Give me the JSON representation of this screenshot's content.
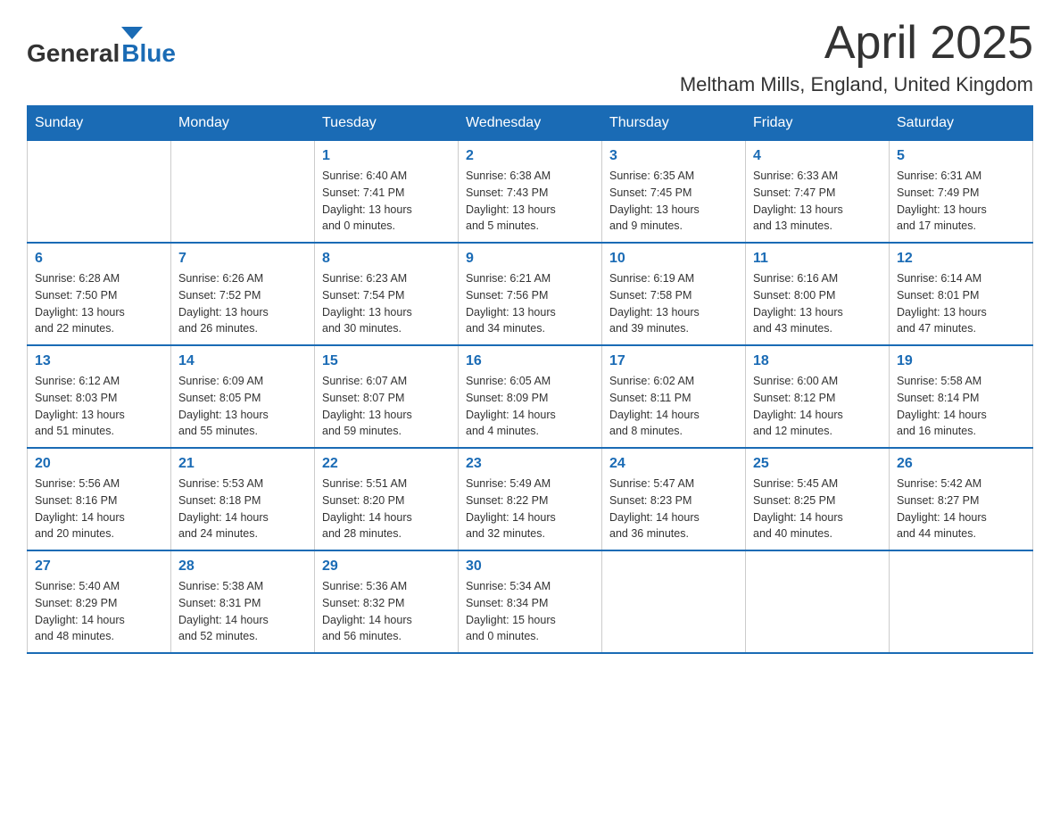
{
  "header": {
    "logo_general": "General",
    "logo_blue": "Blue",
    "month_year": "April 2025",
    "location": "Meltham Mills, England, United Kingdom"
  },
  "weekdays": [
    "Sunday",
    "Monday",
    "Tuesday",
    "Wednesday",
    "Thursday",
    "Friday",
    "Saturday"
  ],
  "weeks": [
    [
      {
        "day": "",
        "info": []
      },
      {
        "day": "",
        "info": []
      },
      {
        "day": "1",
        "info": [
          "Sunrise: 6:40 AM",
          "Sunset: 7:41 PM",
          "Daylight: 13 hours",
          "and 0 minutes."
        ]
      },
      {
        "day": "2",
        "info": [
          "Sunrise: 6:38 AM",
          "Sunset: 7:43 PM",
          "Daylight: 13 hours",
          "and 5 minutes."
        ]
      },
      {
        "day": "3",
        "info": [
          "Sunrise: 6:35 AM",
          "Sunset: 7:45 PM",
          "Daylight: 13 hours",
          "and 9 minutes."
        ]
      },
      {
        "day": "4",
        "info": [
          "Sunrise: 6:33 AM",
          "Sunset: 7:47 PM",
          "Daylight: 13 hours",
          "and 13 minutes."
        ]
      },
      {
        "day": "5",
        "info": [
          "Sunrise: 6:31 AM",
          "Sunset: 7:49 PM",
          "Daylight: 13 hours",
          "and 17 minutes."
        ]
      }
    ],
    [
      {
        "day": "6",
        "info": [
          "Sunrise: 6:28 AM",
          "Sunset: 7:50 PM",
          "Daylight: 13 hours",
          "and 22 minutes."
        ]
      },
      {
        "day": "7",
        "info": [
          "Sunrise: 6:26 AM",
          "Sunset: 7:52 PM",
          "Daylight: 13 hours",
          "and 26 minutes."
        ]
      },
      {
        "day": "8",
        "info": [
          "Sunrise: 6:23 AM",
          "Sunset: 7:54 PM",
          "Daylight: 13 hours",
          "and 30 minutes."
        ]
      },
      {
        "day": "9",
        "info": [
          "Sunrise: 6:21 AM",
          "Sunset: 7:56 PM",
          "Daylight: 13 hours",
          "and 34 minutes."
        ]
      },
      {
        "day": "10",
        "info": [
          "Sunrise: 6:19 AM",
          "Sunset: 7:58 PM",
          "Daylight: 13 hours",
          "and 39 minutes."
        ]
      },
      {
        "day": "11",
        "info": [
          "Sunrise: 6:16 AM",
          "Sunset: 8:00 PM",
          "Daylight: 13 hours",
          "and 43 minutes."
        ]
      },
      {
        "day": "12",
        "info": [
          "Sunrise: 6:14 AM",
          "Sunset: 8:01 PM",
          "Daylight: 13 hours",
          "and 47 minutes."
        ]
      }
    ],
    [
      {
        "day": "13",
        "info": [
          "Sunrise: 6:12 AM",
          "Sunset: 8:03 PM",
          "Daylight: 13 hours",
          "and 51 minutes."
        ]
      },
      {
        "day": "14",
        "info": [
          "Sunrise: 6:09 AM",
          "Sunset: 8:05 PM",
          "Daylight: 13 hours",
          "and 55 minutes."
        ]
      },
      {
        "day": "15",
        "info": [
          "Sunrise: 6:07 AM",
          "Sunset: 8:07 PM",
          "Daylight: 13 hours",
          "and 59 minutes."
        ]
      },
      {
        "day": "16",
        "info": [
          "Sunrise: 6:05 AM",
          "Sunset: 8:09 PM",
          "Daylight: 14 hours",
          "and 4 minutes."
        ]
      },
      {
        "day": "17",
        "info": [
          "Sunrise: 6:02 AM",
          "Sunset: 8:11 PM",
          "Daylight: 14 hours",
          "and 8 minutes."
        ]
      },
      {
        "day": "18",
        "info": [
          "Sunrise: 6:00 AM",
          "Sunset: 8:12 PM",
          "Daylight: 14 hours",
          "and 12 minutes."
        ]
      },
      {
        "day": "19",
        "info": [
          "Sunrise: 5:58 AM",
          "Sunset: 8:14 PM",
          "Daylight: 14 hours",
          "and 16 minutes."
        ]
      }
    ],
    [
      {
        "day": "20",
        "info": [
          "Sunrise: 5:56 AM",
          "Sunset: 8:16 PM",
          "Daylight: 14 hours",
          "and 20 minutes."
        ]
      },
      {
        "day": "21",
        "info": [
          "Sunrise: 5:53 AM",
          "Sunset: 8:18 PM",
          "Daylight: 14 hours",
          "and 24 minutes."
        ]
      },
      {
        "day": "22",
        "info": [
          "Sunrise: 5:51 AM",
          "Sunset: 8:20 PM",
          "Daylight: 14 hours",
          "and 28 minutes."
        ]
      },
      {
        "day": "23",
        "info": [
          "Sunrise: 5:49 AM",
          "Sunset: 8:22 PM",
          "Daylight: 14 hours",
          "and 32 minutes."
        ]
      },
      {
        "day": "24",
        "info": [
          "Sunrise: 5:47 AM",
          "Sunset: 8:23 PM",
          "Daylight: 14 hours",
          "and 36 minutes."
        ]
      },
      {
        "day": "25",
        "info": [
          "Sunrise: 5:45 AM",
          "Sunset: 8:25 PM",
          "Daylight: 14 hours",
          "and 40 minutes."
        ]
      },
      {
        "day": "26",
        "info": [
          "Sunrise: 5:42 AM",
          "Sunset: 8:27 PM",
          "Daylight: 14 hours",
          "and 44 minutes."
        ]
      }
    ],
    [
      {
        "day": "27",
        "info": [
          "Sunrise: 5:40 AM",
          "Sunset: 8:29 PM",
          "Daylight: 14 hours",
          "and 48 minutes."
        ]
      },
      {
        "day": "28",
        "info": [
          "Sunrise: 5:38 AM",
          "Sunset: 8:31 PM",
          "Daylight: 14 hours",
          "and 52 minutes."
        ]
      },
      {
        "day": "29",
        "info": [
          "Sunrise: 5:36 AM",
          "Sunset: 8:32 PM",
          "Daylight: 14 hours",
          "and 56 minutes."
        ]
      },
      {
        "day": "30",
        "info": [
          "Sunrise: 5:34 AM",
          "Sunset: 8:34 PM",
          "Daylight: 15 hours",
          "and 0 minutes."
        ]
      },
      {
        "day": "",
        "info": []
      },
      {
        "day": "",
        "info": []
      },
      {
        "day": "",
        "info": []
      }
    ]
  ]
}
